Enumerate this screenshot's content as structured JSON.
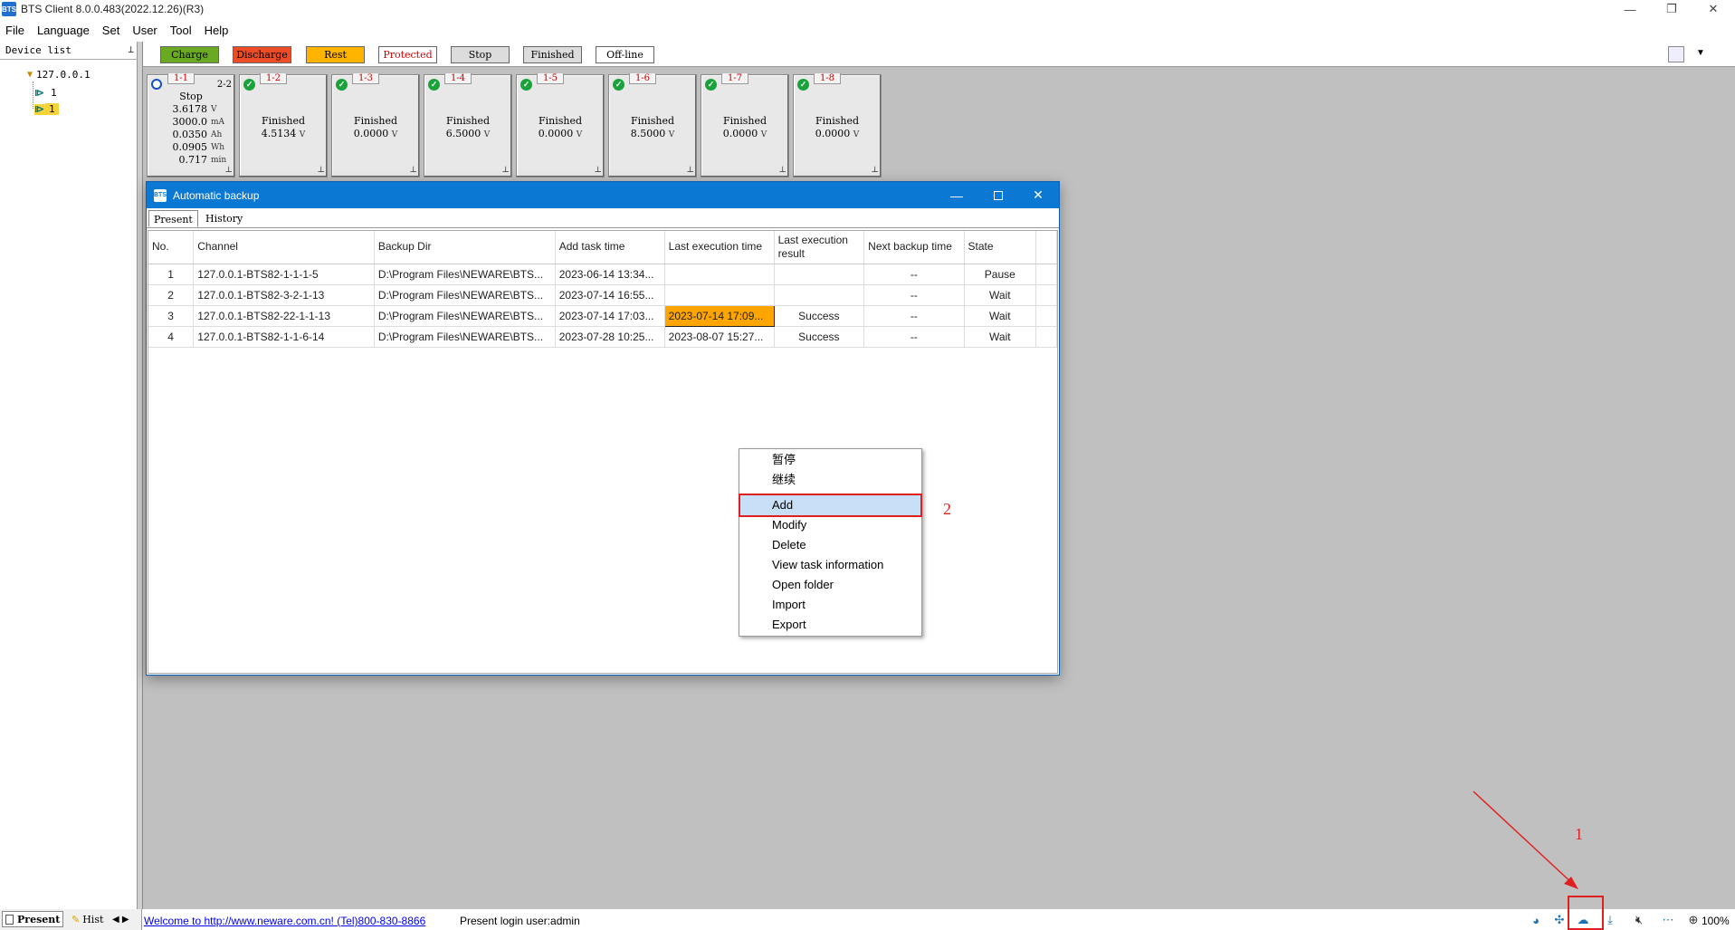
{
  "window": {
    "title": "BTS Client 8.0.0.483(2022.12.26)(R3)",
    "logo_text": "BTS",
    "minimize": "—",
    "restore": "❐",
    "close": "✕"
  },
  "menu": [
    "File",
    "Language",
    "Set",
    "User",
    "Tool",
    "Help"
  ],
  "device_panel": {
    "title": "Device list",
    "pin": "⊥",
    "tree": {
      "ip": "127.0.0.1",
      "nodes": [
        "1",
        "1"
      ]
    }
  },
  "legend": [
    {
      "label": "Charge",
      "color": "#6aaa22",
      "text_color": "#000000"
    },
    {
      "label": "Discharge",
      "color": "#ec4c26",
      "text_color": "#000000"
    },
    {
      "label": "Rest",
      "color": "#ffb400",
      "text_color": "#000000"
    },
    {
      "label": "Protected",
      "color": "#ffffff",
      "text_color": "#d40000"
    },
    {
      "label": "Stop",
      "color": "#dcdcdc",
      "text_color": "#000000"
    },
    {
      "label": "Finished",
      "color": "#dcdcdc",
      "text_color": "#000000"
    },
    {
      "label": "Off-line",
      "color": "#ffffff",
      "text_color": "#000000"
    }
  ],
  "channels": [
    {
      "id": "1-1",
      "extra": "2-2",
      "status": "Stop",
      "readings": [
        {
          "value": "3.6178",
          "unit": "V"
        },
        {
          "value": "3000.0",
          "unit": "mA"
        },
        {
          "value": "0.0350",
          "unit": "Ah"
        },
        {
          "value": "0.0905",
          "unit": "Wh"
        },
        {
          "value": "0.717",
          "unit": "min"
        }
      ]
    },
    {
      "id": "1-2",
      "status": "Finished",
      "voltage": "4.5134",
      "unit": "V"
    },
    {
      "id": "1-3",
      "status": "Finished",
      "voltage": "0.0000",
      "unit": "V"
    },
    {
      "id": "1-4",
      "status": "Finished",
      "voltage": "6.5000",
      "unit": "V"
    },
    {
      "id": "1-5",
      "status": "Finished",
      "voltage": "0.0000",
      "unit": "V"
    },
    {
      "id": "1-6",
      "status": "Finished",
      "voltage": "8.5000",
      "unit": "V"
    },
    {
      "id": "1-7",
      "status": "Finished",
      "voltage": "0.0000",
      "unit": "V"
    },
    {
      "id": "1-8",
      "status": "Finished",
      "voltage": "0.0000",
      "unit": "V"
    }
  ],
  "dialog": {
    "title": "Automatic backup",
    "tabs": [
      "Present",
      "History"
    ],
    "columns": [
      "No.",
      "Channel",
      "Backup Dir",
      "Add task time",
      "Last execution time",
      "Last execution result",
      "Next backup time",
      "State"
    ],
    "rows": [
      [
        "1",
        "127.0.0.1-BTS82-1-1-1-5",
        "D:\\Program Files\\NEWARE\\BTS...",
        "2023-06-14 13:34...",
        "",
        "",
        "--",
        "Pause"
      ],
      [
        "2",
        "127.0.0.1-BTS82-3-2-1-13",
        "D:\\Program Files\\NEWARE\\BTS...",
        "2023-07-14 16:55...",
        "",
        "",
        "--",
        "Wait"
      ],
      [
        "3",
        "127.0.0.1-BTS82-22-1-1-13",
        "D:\\Program Files\\NEWARE\\BTS...",
        "2023-07-14 17:03...",
        "2023-07-14 17:09...",
        "Success",
        "--",
        "Wait"
      ],
      [
        "4",
        "127.0.0.1-BTS82-1-1-6-14",
        "D:\\Program Files\\NEWARE\\BTS...",
        "2023-07-28 10:25...",
        "2023-08-07 15:27...",
        "Success",
        "--",
        "Wait"
      ]
    ]
  },
  "context_menu": [
    "暂停",
    "继续",
    "Add",
    "Modify",
    "Delete",
    "View task information",
    "Open folder",
    "Import",
    "Export"
  ],
  "annotations": {
    "step1": "1",
    "step2": "2",
    "accent": "#e02020"
  },
  "status_bar": {
    "tabs": [
      "Present",
      "Hist"
    ],
    "welcome": "Welcome to http://www.neware.com.cn! (Tel)800-830-8866",
    "login": "Present login user:admin",
    "zoom": "100%"
  }
}
